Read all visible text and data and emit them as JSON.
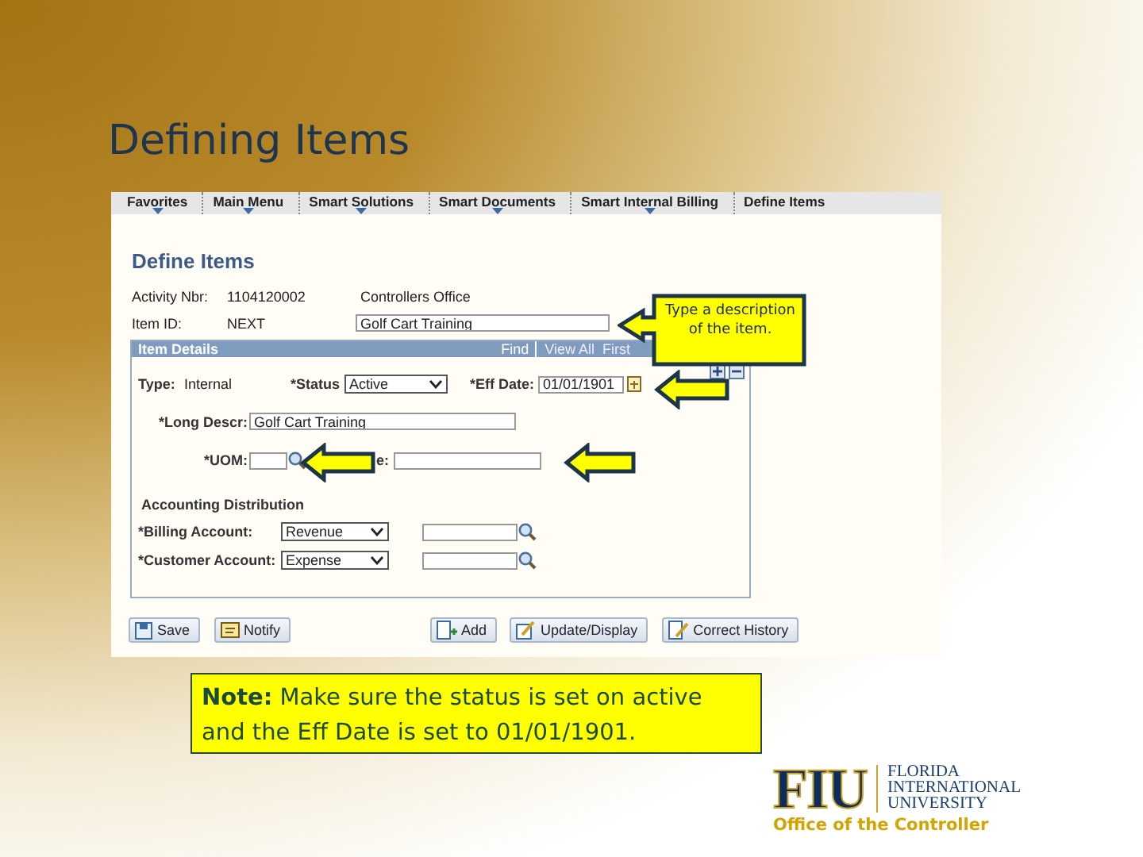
{
  "slide": {
    "title": "Defining Items"
  },
  "nav": {
    "items": [
      {
        "label": "Favorites",
        "has_menu": true
      },
      {
        "label": "Main Menu",
        "has_menu": true
      },
      {
        "label": "Smart Solutions",
        "has_menu": true
      },
      {
        "label": "Smart Documents",
        "has_menu": true
      },
      {
        "label": "Smart Internal Billing",
        "has_menu": true
      },
      {
        "label": "Define Items",
        "has_menu": false
      }
    ]
  },
  "page_title": "Define Items",
  "activity": {
    "label": "Activity Nbr:",
    "value": "1104120002",
    "name": "Controllers Office"
  },
  "item_id": {
    "label": "Item ID:",
    "value": "NEXT",
    "description": "Golf Cart Training"
  },
  "item_details": {
    "title": "Item Details",
    "links": [
      "Find",
      "View All",
      "First"
    ],
    "type": {
      "label": "Type:",
      "value": "Internal"
    },
    "status": {
      "label": "*Status",
      "value": "Active"
    },
    "eff_date": {
      "label": "*Eff Date:",
      "value": "01/01/1901"
    },
    "long_descr": {
      "label": "*Long Descr:",
      "value": "Golf Cart Training"
    },
    "uom": {
      "label": "*UOM:"
    },
    "uom_descr": {
      "label": "e:"
    },
    "accounting": {
      "title": "Accounting Distribution",
      "rows": [
        {
          "label": "*Billing Account:",
          "value": "Revenue"
        },
        {
          "label": "*Customer Account:",
          "value": "Expense"
        }
      ]
    }
  },
  "buttons": [
    {
      "label": "Save",
      "kind": "save"
    },
    {
      "label": "Notify",
      "kind": "notify"
    },
    {
      "label": "Add",
      "kind": "add"
    },
    {
      "label": "Update/Display",
      "kind": "update"
    },
    {
      "label": "Correct History",
      "kind": "history"
    }
  ],
  "callouts": [
    {
      "text": "Type a description of the item."
    }
  ],
  "note": "**Note:** Make sure the status is set on active and the Eff Date is set to 01/01/1901.",
  "logo": {
    "mark": "FIU",
    "lines": [
      "FLORIDA",
      "INTERNATIONAL",
      "UNIVERSITY"
    ],
    "tagline": "Office of the Controller"
  }
}
